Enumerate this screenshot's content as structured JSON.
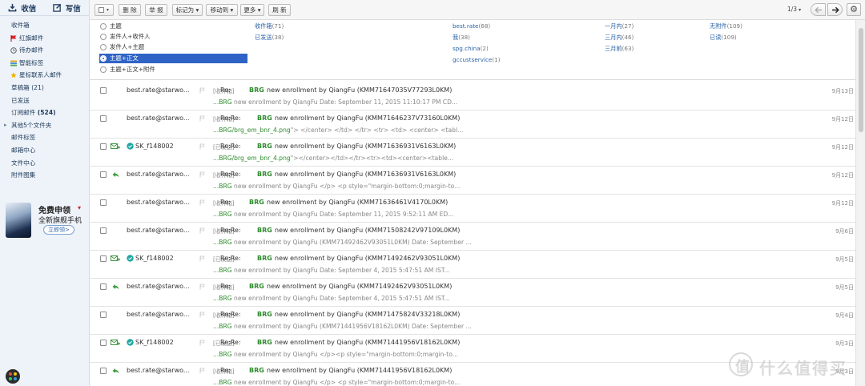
{
  "sidebar": {
    "receive_label": "收信",
    "compose_label": "写信",
    "items": [
      {
        "label": "收件箱",
        "icon": ""
      },
      {
        "label": "红旗邮件",
        "icon": "red-flag-icon"
      },
      {
        "label": "待办邮件",
        "icon": "clock-icon"
      },
      {
        "label": "智能标签",
        "icon": "tag-stack-icon"
      },
      {
        "label": "星标联系人邮件",
        "icon": "star-icon"
      },
      {
        "label": "草稿箱 (21)",
        "icon": ""
      },
      {
        "label": "已发送",
        "icon": ""
      },
      {
        "label": "订阅邮件",
        "count": "(524)",
        "icon": ""
      },
      {
        "label": "其他5个文件夹",
        "icon": "",
        "caret": "▸"
      },
      {
        "label": "邮件标签",
        "icon": ""
      },
      {
        "label": "邮箱中心",
        "icon": ""
      },
      {
        "label": "文件中心",
        "icon": ""
      },
      {
        "label": "附件图集",
        "icon": ""
      }
    ],
    "promo": {
      "title": "免费申领",
      "title_mark": "▾",
      "subtitle": "全新旗舰手机",
      "button": "立即领>"
    }
  },
  "toolbar": {
    "delete": "删 除",
    "report": "举 报",
    "mark_as": "标记为 ▾",
    "move_to": "移动到 ▾",
    "more": "更多 ▾",
    "refresh": "刷 新",
    "page_indicator": "1/3",
    "page_dropdown": "▾"
  },
  "search_scope": {
    "options": [
      {
        "label": "主题",
        "selected": false
      },
      {
        "label": "发件人+收件人",
        "selected": false
      },
      {
        "label": "发件人+主题",
        "selected": false
      },
      {
        "label": "主题+正文",
        "selected": true
      },
      {
        "label": "主题+正文+附件",
        "selected": false
      }
    ],
    "folders": [
      {
        "label": "收件箱",
        "count": "(71)"
      },
      {
        "label": "已发送",
        "count": "(38)"
      }
    ],
    "senders": [
      {
        "label": "best.rate",
        "count": "(68)"
      },
      {
        "label": "我",
        "count": "(38)"
      },
      {
        "label": "spg.china",
        "count": "(2)"
      },
      {
        "label": "gccustservice",
        "count": "(1)"
      }
    ],
    "times": [
      {
        "label": "一月内",
        "count": "(27)"
      },
      {
        "label": "三月内",
        "count": "(46)"
      },
      {
        "label": "三月前",
        "count": "(63)"
      }
    ],
    "attachments": [
      {
        "label": "无附件",
        "count": "(109)"
      },
      {
        "label": "已读",
        "count": "(109)"
      }
    ]
  },
  "emails": [
    {
      "status": "none",
      "sender": "best.rate@starwo...",
      "tag": "[收件箱]",
      "re": "Re:",
      "brg": "BRG",
      "subject": "new enrollment by QiangFu (KMM71647035V77293L0KM)",
      "snippet_hl": "...BRG",
      "snippet": " new enrollment by QiangFu Date: September 11, 2015 11:10:17 PM CD...",
      "date": "9月13日"
    },
    {
      "status": "none",
      "sender": "best.rate@starwo...",
      "tag": "[收件箱]",
      "re": "Re:Re:",
      "brg": "BRG",
      "subject": "new enrollment by QiangFu (KMM71646237V73160L0KM)",
      "snippet_hl": "...BRG/brg_em_bnr_4.png",
      "snippet": "\"> </center> </td> </tr> <tr> <td> <center> <tabl...",
      "date": "9月12日"
    },
    {
      "status": "sent",
      "sender": "SK_f148002",
      "tag": "[已发送]",
      "re": "Re:Re:",
      "brg": "BRG",
      "subject": "new enrollment by QiangFu (KMM71636931V6163L0KM)",
      "snippet_hl": "...BRG/brg_em_bnr_4.png",
      "snippet": "\"></center></td></tr><tr><td><center><table...",
      "date": "9月12日"
    },
    {
      "status": "replied",
      "sender": "best.rate@starwo...",
      "tag": "[收件箱]",
      "re": "Re:Re:",
      "brg": "BRG",
      "subject": "new enrollment by QiangFu (KMM71636931V6163L0KM)",
      "snippet_hl": "...BRG",
      "snippet": " new enrollment by QiangFu </p> <p style=\"margin-bottom:0;margin-to...",
      "date": "9月12日"
    },
    {
      "status": "none",
      "sender": "best.rate@starwo...",
      "tag": "[收件箱]",
      "re": "Re:",
      "brg": "BRG",
      "subject": "new enrollment by QiangFu (KMM71636461V4170L0KM)",
      "snippet_hl": "...BRG",
      "snippet": " new enrollment by QiangFu Date: September 11, 2015 9:52:11 AM ED...",
      "date": "9月12日"
    },
    {
      "status": "none",
      "sender": "best.rate@starwo...",
      "tag": "[收件箱]",
      "re": "Re:Re:",
      "brg": "BRG",
      "subject": "new enrollment by QiangFu (KMM71508242V97109L0KM)",
      "snippet_hl": "...BRG",
      "snippet": " new enrollment by QiangFu (KMM71492462V93051L0KM) Date: September ...",
      "date": "9月6日"
    },
    {
      "status": "sent",
      "sender": "SK_f148002",
      "tag": "[已发送]",
      "re": "Re:Re:",
      "brg": "BRG",
      "subject": "new enrollment by QiangFu (KMM71492462V93051L0KM)",
      "snippet_hl": "...BRG",
      "snippet": " new enrollment by QiangFu Date: September 4, 2015 5:47:51 AM IST...",
      "date": "9月5日"
    },
    {
      "status": "replied",
      "sender": "best.rate@starwo...",
      "tag": "[收件箱]",
      "re": "Re:",
      "brg": "BRG",
      "subject": "new enrollment by QiangFu (KMM71492462V93051L0KM)",
      "snippet_hl": "...BRG",
      "snippet": " new enrollment by QiangFu Date: September 4, 2015 5:47:51 AM IST...",
      "date": "9月5日"
    },
    {
      "status": "none",
      "sender": "best.rate@starwo...",
      "tag": "[收件箱]",
      "re": "Re:Re:",
      "brg": "BRG",
      "subject": "new enrollment by QiangFu (KMM71475824V33218L0KM)",
      "snippet_hl": "...BRG",
      "snippet": " new enrollment by QiangFu (KMM71441956V18162L0KM) Date: September ...",
      "date": "9月4日"
    },
    {
      "status": "sent",
      "sender": "SK_f148002",
      "tag": "[已发送]",
      "re": "Re:Re:",
      "brg": "BRG",
      "subject": "new enrollment by QiangFu (KMM71441956V18162L0KM)",
      "snippet_hl": "...BRG",
      "snippet": " new enrollment by QiangFu </p><p style=\"margin-bottom:0;margin-to...",
      "date": "9月3日"
    },
    {
      "status": "replied",
      "sender": "best.rate@starwo...",
      "tag": "[收件箱]",
      "re": "Re:",
      "brg": "BRG",
      "subject": "new enrollment by QiangFu (KMM71441956V18162L0KM)",
      "snippet_hl": "...BRG",
      "snippet": " new enrollment by QiangFu </p> <p style=\"margin-bottom:0;margin-to...",
      "date": "9月3日"
    }
  ],
  "watermark": {
    "logo_char": "值",
    "text": "什么值得买"
  },
  "colors": {
    "accent": "#2f63c6",
    "brg_green": "#2e8b2e",
    "link_blue": "#2a62a8",
    "flag_red": "#d22",
    "sidebar_bg": "#eef3f9"
  }
}
